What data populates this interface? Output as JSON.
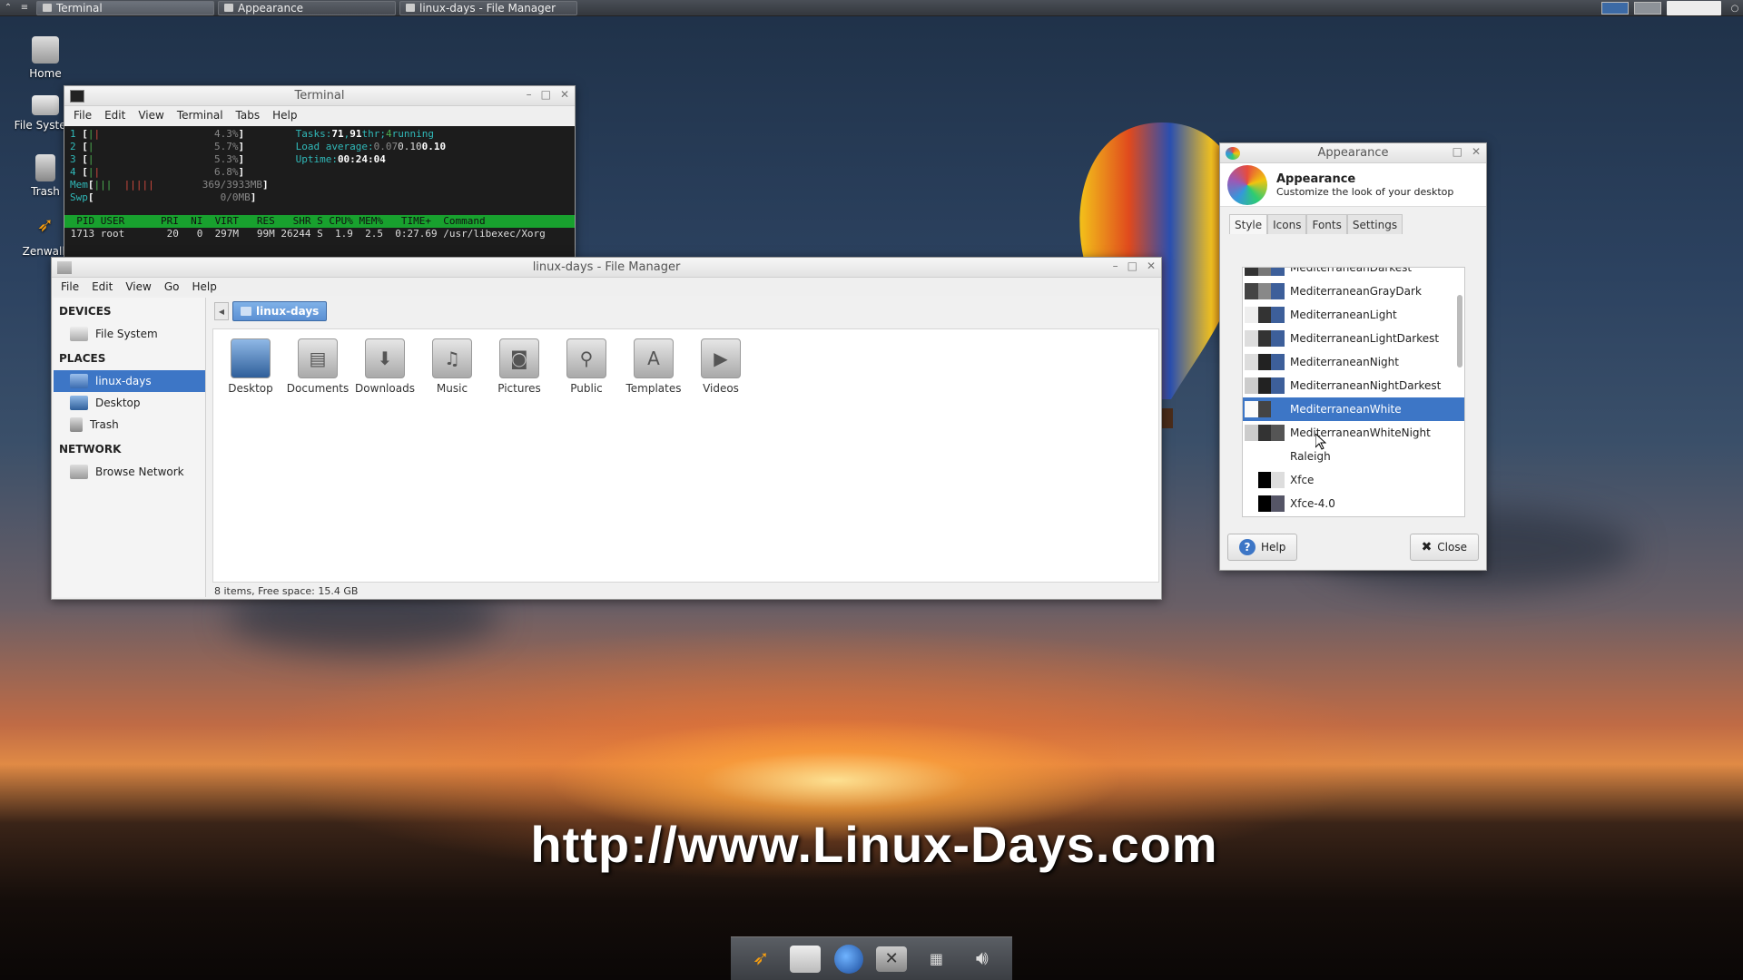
{
  "top_panel": {
    "tasks": [
      {
        "label": "Terminal"
      },
      {
        "label": "Appearance"
      },
      {
        "label": "linux-days - File Manager"
      }
    ]
  },
  "desktop_icons": [
    {
      "label": "Home"
    },
    {
      "label": "File System"
    },
    {
      "label": "Trash"
    },
    {
      "label": "Zenwalk"
    }
  ],
  "terminal": {
    "title": "Terminal",
    "menu": [
      "File",
      "Edit",
      "View",
      "Terminal",
      "Tabs",
      "Help"
    ],
    "cpus": [
      {
        "n": "1",
        "pct": "4.3%"
      },
      {
        "n": "2",
        "pct": "5.7%"
      },
      {
        "n": "3",
        "pct": "5.3%"
      },
      {
        "n": "4",
        "pct": "6.8%"
      }
    ],
    "mem": "369/3933MB",
    "swp": "0/0MB",
    "tasks_line": {
      "label": "Tasks:",
      "tasks": "71",
      "sep": ",",
      "thr_n": "91",
      "thr": "thr;",
      "running_n": "4",
      "running": "running"
    },
    "load_line": {
      "label": "Load average:",
      "a": "0.07",
      "b": "0.10",
      "c": "0.10"
    },
    "uptime_line": {
      "label": "Uptime:",
      "value": "00:24:04"
    },
    "header": "  PID USER      PRI  NI  VIRT   RES   SHR S CPU% MEM%   TIME+  Command",
    "process": " 1713 root       20   0  297M   99M 26244 S  1.9  2.5  0:27.69 /usr/libexec/Xorg"
  },
  "file_manager": {
    "title": "linux-days - File Manager",
    "menu": [
      "File",
      "Edit",
      "View",
      "Go",
      "Help"
    ],
    "sections": {
      "devices": "DEVICES",
      "places": "PLACES",
      "network": "NETWORK"
    },
    "devices": [
      {
        "label": "File System"
      }
    ],
    "places": [
      {
        "label": "linux-days",
        "selected": true
      },
      {
        "label": "Desktop"
      },
      {
        "label": "Trash"
      }
    ],
    "network": [
      {
        "label": "Browse Network"
      }
    ],
    "path": "linux-days",
    "items": [
      {
        "label": "Desktop"
      },
      {
        "label": "Documents"
      },
      {
        "label": "Downloads"
      },
      {
        "label": "Music"
      },
      {
        "label": "Pictures"
      },
      {
        "label": "Public"
      },
      {
        "label": "Templates"
      },
      {
        "label": "Videos"
      }
    ],
    "status": "8 items, Free space: 15.4 GB"
  },
  "appearance": {
    "title": "Appearance",
    "heading": "Appearance",
    "subheading": "Customize the look of your desktop",
    "tabs": [
      "Style",
      "Icons",
      "Fonts",
      "Settings"
    ],
    "themes": [
      {
        "name": "MediterraneanDarkest"
      },
      {
        "name": "MediterraneanGrayDark"
      },
      {
        "name": "MediterraneanLight"
      },
      {
        "name": "MediterraneanLightDarkest"
      },
      {
        "name": "MediterraneanNight"
      },
      {
        "name": "MediterraneanNightDarkest"
      },
      {
        "name": "MediterraneanWhite",
        "selected": true
      },
      {
        "name": "MediterraneanWhiteNight"
      },
      {
        "name": "Raleigh"
      },
      {
        "name": "Xfce"
      },
      {
        "name": "Xfce-4.0"
      }
    ],
    "help_label": "Help",
    "close_label": "Close"
  },
  "watermark": "http://www.Linux-Days.com",
  "colors": {
    "accent": "#3d76c6",
    "htop_header": "#18a12e"
  }
}
